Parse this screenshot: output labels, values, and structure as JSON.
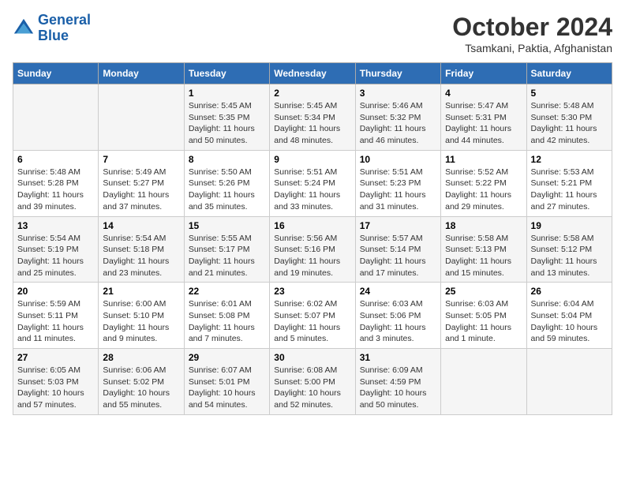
{
  "logo": {
    "line1": "General",
    "line2": "Blue"
  },
  "title": "October 2024",
  "location": "Tsamkani, Paktia, Afghanistan",
  "days_of_week": [
    "Sunday",
    "Monday",
    "Tuesday",
    "Wednesday",
    "Thursday",
    "Friday",
    "Saturday"
  ],
  "weeks": [
    [
      {
        "day": "",
        "sunrise": "",
        "sunset": "",
        "daylight": ""
      },
      {
        "day": "",
        "sunrise": "",
        "sunset": "",
        "daylight": ""
      },
      {
        "day": "1",
        "sunrise": "Sunrise: 5:45 AM",
        "sunset": "Sunset: 5:35 PM",
        "daylight": "Daylight: 11 hours and 50 minutes."
      },
      {
        "day": "2",
        "sunrise": "Sunrise: 5:45 AM",
        "sunset": "Sunset: 5:34 PM",
        "daylight": "Daylight: 11 hours and 48 minutes."
      },
      {
        "day": "3",
        "sunrise": "Sunrise: 5:46 AM",
        "sunset": "Sunset: 5:32 PM",
        "daylight": "Daylight: 11 hours and 46 minutes."
      },
      {
        "day": "4",
        "sunrise": "Sunrise: 5:47 AM",
        "sunset": "Sunset: 5:31 PM",
        "daylight": "Daylight: 11 hours and 44 minutes."
      },
      {
        "day": "5",
        "sunrise": "Sunrise: 5:48 AM",
        "sunset": "Sunset: 5:30 PM",
        "daylight": "Daylight: 11 hours and 42 minutes."
      }
    ],
    [
      {
        "day": "6",
        "sunrise": "Sunrise: 5:48 AM",
        "sunset": "Sunset: 5:28 PM",
        "daylight": "Daylight: 11 hours and 39 minutes."
      },
      {
        "day": "7",
        "sunrise": "Sunrise: 5:49 AM",
        "sunset": "Sunset: 5:27 PM",
        "daylight": "Daylight: 11 hours and 37 minutes."
      },
      {
        "day": "8",
        "sunrise": "Sunrise: 5:50 AM",
        "sunset": "Sunset: 5:26 PM",
        "daylight": "Daylight: 11 hours and 35 minutes."
      },
      {
        "day": "9",
        "sunrise": "Sunrise: 5:51 AM",
        "sunset": "Sunset: 5:24 PM",
        "daylight": "Daylight: 11 hours and 33 minutes."
      },
      {
        "day": "10",
        "sunrise": "Sunrise: 5:51 AM",
        "sunset": "Sunset: 5:23 PM",
        "daylight": "Daylight: 11 hours and 31 minutes."
      },
      {
        "day": "11",
        "sunrise": "Sunrise: 5:52 AM",
        "sunset": "Sunset: 5:22 PM",
        "daylight": "Daylight: 11 hours and 29 minutes."
      },
      {
        "day": "12",
        "sunrise": "Sunrise: 5:53 AM",
        "sunset": "Sunset: 5:21 PM",
        "daylight": "Daylight: 11 hours and 27 minutes."
      }
    ],
    [
      {
        "day": "13",
        "sunrise": "Sunrise: 5:54 AM",
        "sunset": "Sunset: 5:19 PM",
        "daylight": "Daylight: 11 hours and 25 minutes."
      },
      {
        "day": "14",
        "sunrise": "Sunrise: 5:54 AM",
        "sunset": "Sunset: 5:18 PM",
        "daylight": "Daylight: 11 hours and 23 minutes."
      },
      {
        "day": "15",
        "sunrise": "Sunrise: 5:55 AM",
        "sunset": "Sunset: 5:17 PM",
        "daylight": "Daylight: 11 hours and 21 minutes."
      },
      {
        "day": "16",
        "sunrise": "Sunrise: 5:56 AM",
        "sunset": "Sunset: 5:16 PM",
        "daylight": "Daylight: 11 hours and 19 minutes."
      },
      {
        "day": "17",
        "sunrise": "Sunrise: 5:57 AM",
        "sunset": "Sunset: 5:14 PM",
        "daylight": "Daylight: 11 hours and 17 minutes."
      },
      {
        "day": "18",
        "sunrise": "Sunrise: 5:58 AM",
        "sunset": "Sunset: 5:13 PM",
        "daylight": "Daylight: 11 hours and 15 minutes."
      },
      {
        "day": "19",
        "sunrise": "Sunrise: 5:58 AM",
        "sunset": "Sunset: 5:12 PM",
        "daylight": "Daylight: 11 hours and 13 minutes."
      }
    ],
    [
      {
        "day": "20",
        "sunrise": "Sunrise: 5:59 AM",
        "sunset": "Sunset: 5:11 PM",
        "daylight": "Daylight: 11 hours and 11 minutes."
      },
      {
        "day": "21",
        "sunrise": "Sunrise: 6:00 AM",
        "sunset": "Sunset: 5:10 PM",
        "daylight": "Daylight: 11 hours and 9 minutes."
      },
      {
        "day": "22",
        "sunrise": "Sunrise: 6:01 AM",
        "sunset": "Sunset: 5:08 PM",
        "daylight": "Daylight: 11 hours and 7 minutes."
      },
      {
        "day": "23",
        "sunrise": "Sunrise: 6:02 AM",
        "sunset": "Sunset: 5:07 PM",
        "daylight": "Daylight: 11 hours and 5 minutes."
      },
      {
        "day": "24",
        "sunrise": "Sunrise: 6:03 AM",
        "sunset": "Sunset: 5:06 PM",
        "daylight": "Daylight: 11 hours and 3 minutes."
      },
      {
        "day": "25",
        "sunrise": "Sunrise: 6:03 AM",
        "sunset": "Sunset: 5:05 PM",
        "daylight": "Daylight: 11 hours and 1 minute."
      },
      {
        "day": "26",
        "sunrise": "Sunrise: 6:04 AM",
        "sunset": "Sunset: 5:04 PM",
        "daylight": "Daylight: 10 hours and 59 minutes."
      }
    ],
    [
      {
        "day": "27",
        "sunrise": "Sunrise: 6:05 AM",
        "sunset": "Sunset: 5:03 PM",
        "daylight": "Daylight: 10 hours and 57 minutes."
      },
      {
        "day": "28",
        "sunrise": "Sunrise: 6:06 AM",
        "sunset": "Sunset: 5:02 PM",
        "daylight": "Daylight: 10 hours and 55 minutes."
      },
      {
        "day": "29",
        "sunrise": "Sunrise: 6:07 AM",
        "sunset": "Sunset: 5:01 PM",
        "daylight": "Daylight: 10 hours and 54 minutes."
      },
      {
        "day": "30",
        "sunrise": "Sunrise: 6:08 AM",
        "sunset": "Sunset: 5:00 PM",
        "daylight": "Daylight: 10 hours and 52 minutes."
      },
      {
        "day": "31",
        "sunrise": "Sunrise: 6:09 AM",
        "sunset": "Sunset: 4:59 PM",
        "daylight": "Daylight: 10 hours and 50 minutes."
      },
      {
        "day": "",
        "sunrise": "",
        "sunset": "",
        "daylight": ""
      },
      {
        "day": "",
        "sunrise": "",
        "sunset": "",
        "daylight": ""
      }
    ]
  ]
}
